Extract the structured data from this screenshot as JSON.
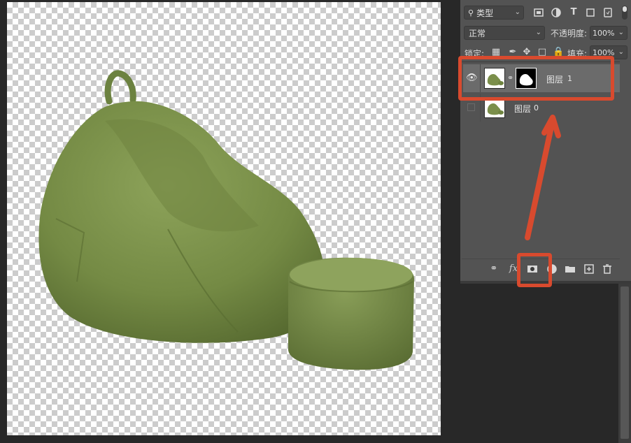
{
  "panel": {
    "filter_label": "类型",
    "blend_mode": "正常",
    "opacity_label": "不透明度:",
    "opacity_value": "100%",
    "lock_label": "锁定:",
    "fill_label": "填充:",
    "fill_value": "100%",
    "filter_icons": [
      "image-icon",
      "adjustment-icon",
      "type-icon",
      "shape-icon",
      "smart-object-icon"
    ],
    "bottom_icons": [
      "link-layers-icon",
      "fx-icon",
      "add-mask-icon",
      "adjustment-layer-icon",
      "folder-icon",
      "new-layer-icon",
      "trash-icon"
    ]
  },
  "layers": [
    {
      "name": "图层",
      "number": "1",
      "visible": true,
      "has_mask": true,
      "selected": true
    },
    {
      "name": "图层",
      "number": "0",
      "visible": false,
      "has_mask": false,
      "selected": false
    }
  ],
  "bottom": {
    "fx_label": "fx"
  },
  "colors": {
    "annotation": "#d84a2e",
    "panel_bg": "#535353",
    "app_bg": "#282828",
    "bag_green": "#7b8f4b"
  }
}
